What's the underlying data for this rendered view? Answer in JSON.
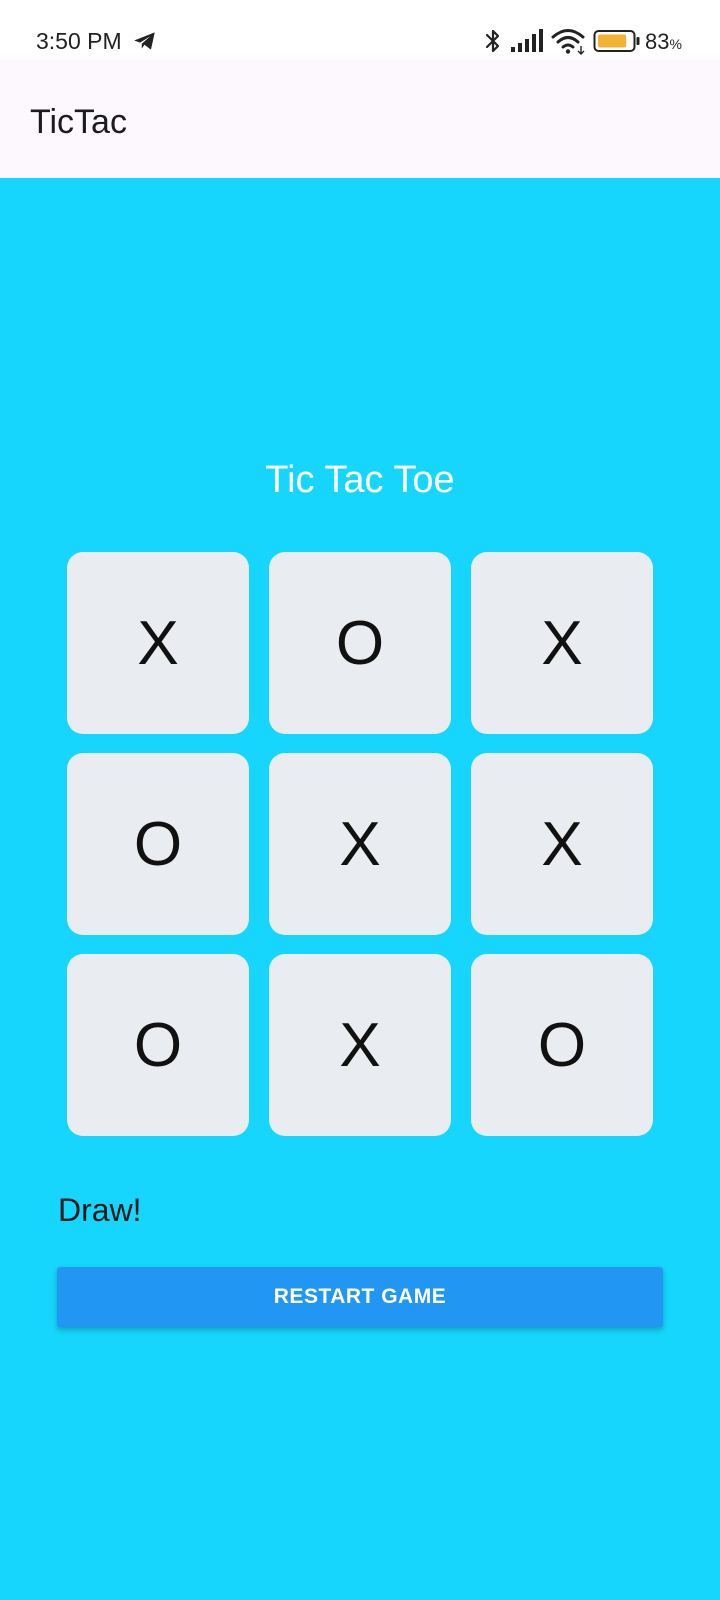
{
  "status_bar": {
    "time": "3:50 PM",
    "battery_percent": "83",
    "battery_percent_sign": "%",
    "battery_level": 0.83,
    "icons": [
      "telegram-icon",
      "bluetooth-icon",
      "signal-icon",
      "wifi-icon",
      "battery-icon"
    ]
  },
  "app_bar": {
    "title": "TicTac"
  },
  "game": {
    "title": "Tic Tac Toe",
    "board": [
      [
        "X",
        "O",
        "X"
      ],
      [
        "O",
        "X",
        "X"
      ],
      [
        "O",
        "X",
        "O"
      ]
    ],
    "result": "Draw!",
    "restart_label": "RESTART GAME"
  },
  "colors": {
    "background": "#16d6fd",
    "app_bar": "#fdf8fd",
    "cell": "#e9edf2",
    "button": "#2196f3",
    "battery_fill": "#f2b233"
  }
}
